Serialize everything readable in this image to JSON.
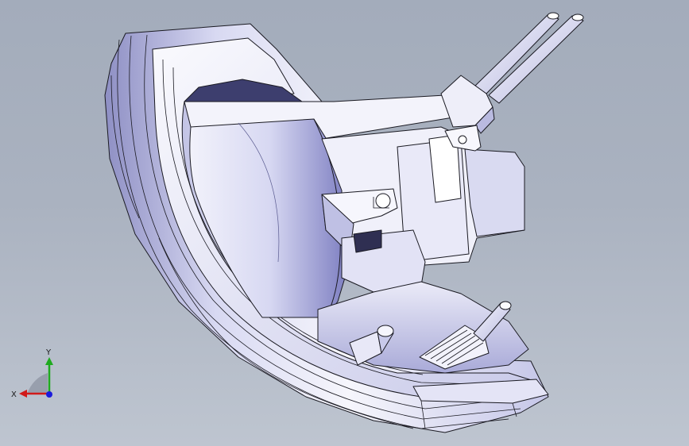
{
  "viewport": {
    "background_top": "#a3acbb",
    "background_bottom": "#bec5d0"
  },
  "model": {
    "shade_light": "#f4f5fb",
    "shade_mid": "#cfd1ee",
    "shade_dark": "#8f90c8",
    "edge_color": "#1a1a22"
  },
  "triad": {
    "x_label": "X",
    "y_label": "Y",
    "x_color": "#d11a1a",
    "y_color": "#1faa1f",
    "z_color": "#1b1bdc"
  }
}
